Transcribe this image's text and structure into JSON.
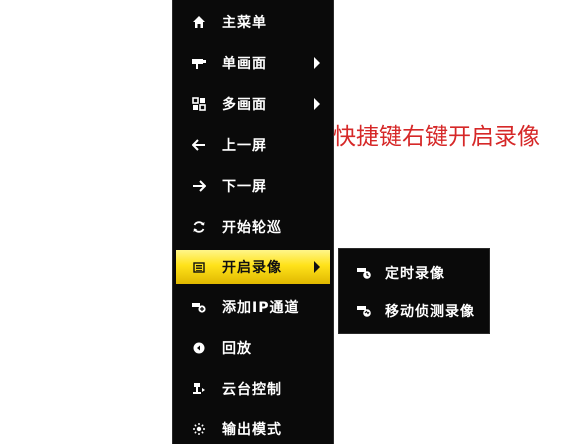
{
  "menu": {
    "items": [
      {
        "label": "主菜单",
        "icon": "home-icon",
        "submenu": false
      },
      {
        "label": "单画面",
        "icon": "camera-icon",
        "submenu": true
      },
      {
        "label": "多画面",
        "icon": "multi-screen-icon",
        "submenu": true
      },
      {
        "label": "上一屏",
        "icon": "arrow-left-icon",
        "submenu": false
      },
      {
        "label": "下一屏",
        "icon": "arrow-right-icon",
        "submenu": false
      },
      {
        "label": "开始轮巡",
        "icon": "cycle-icon",
        "submenu": false
      },
      {
        "label": "开启录像",
        "icon": "record-icon",
        "submenu": true,
        "highlighted": true
      },
      {
        "label": "添加IP通道",
        "icon": "add-ip-camera-icon",
        "submenu": false
      },
      {
        "label": "回放",
        "icon": "playback-icon",
        "submenu": false
      },
      {
        "label": "云台控制",
        "icon": "ptz-icon",
        "submenu": false
      },
      {
        "label": "输出模式",
        "icon": "output-mode-icon",
        "submenu": false
      }
    ]
  },
  "submenu": {
    "items": [
      {
        "label": "定时录像",
        "icon": "scheduled-record-icon"
      },
      {
        "label": "移动侦测录像",
        "icon": "motion-record-icon"
      }
    ]
  },
  "annotation": {
    "text": "快捷键右键开启录像"
  },
  "colors": {
    "menu_background": "#0a0a0a",
    "highlight_yellow": "#ffe21a",
    "annotation_red": "#d62828",
    "text_white": "#ffffff"
  }
}
